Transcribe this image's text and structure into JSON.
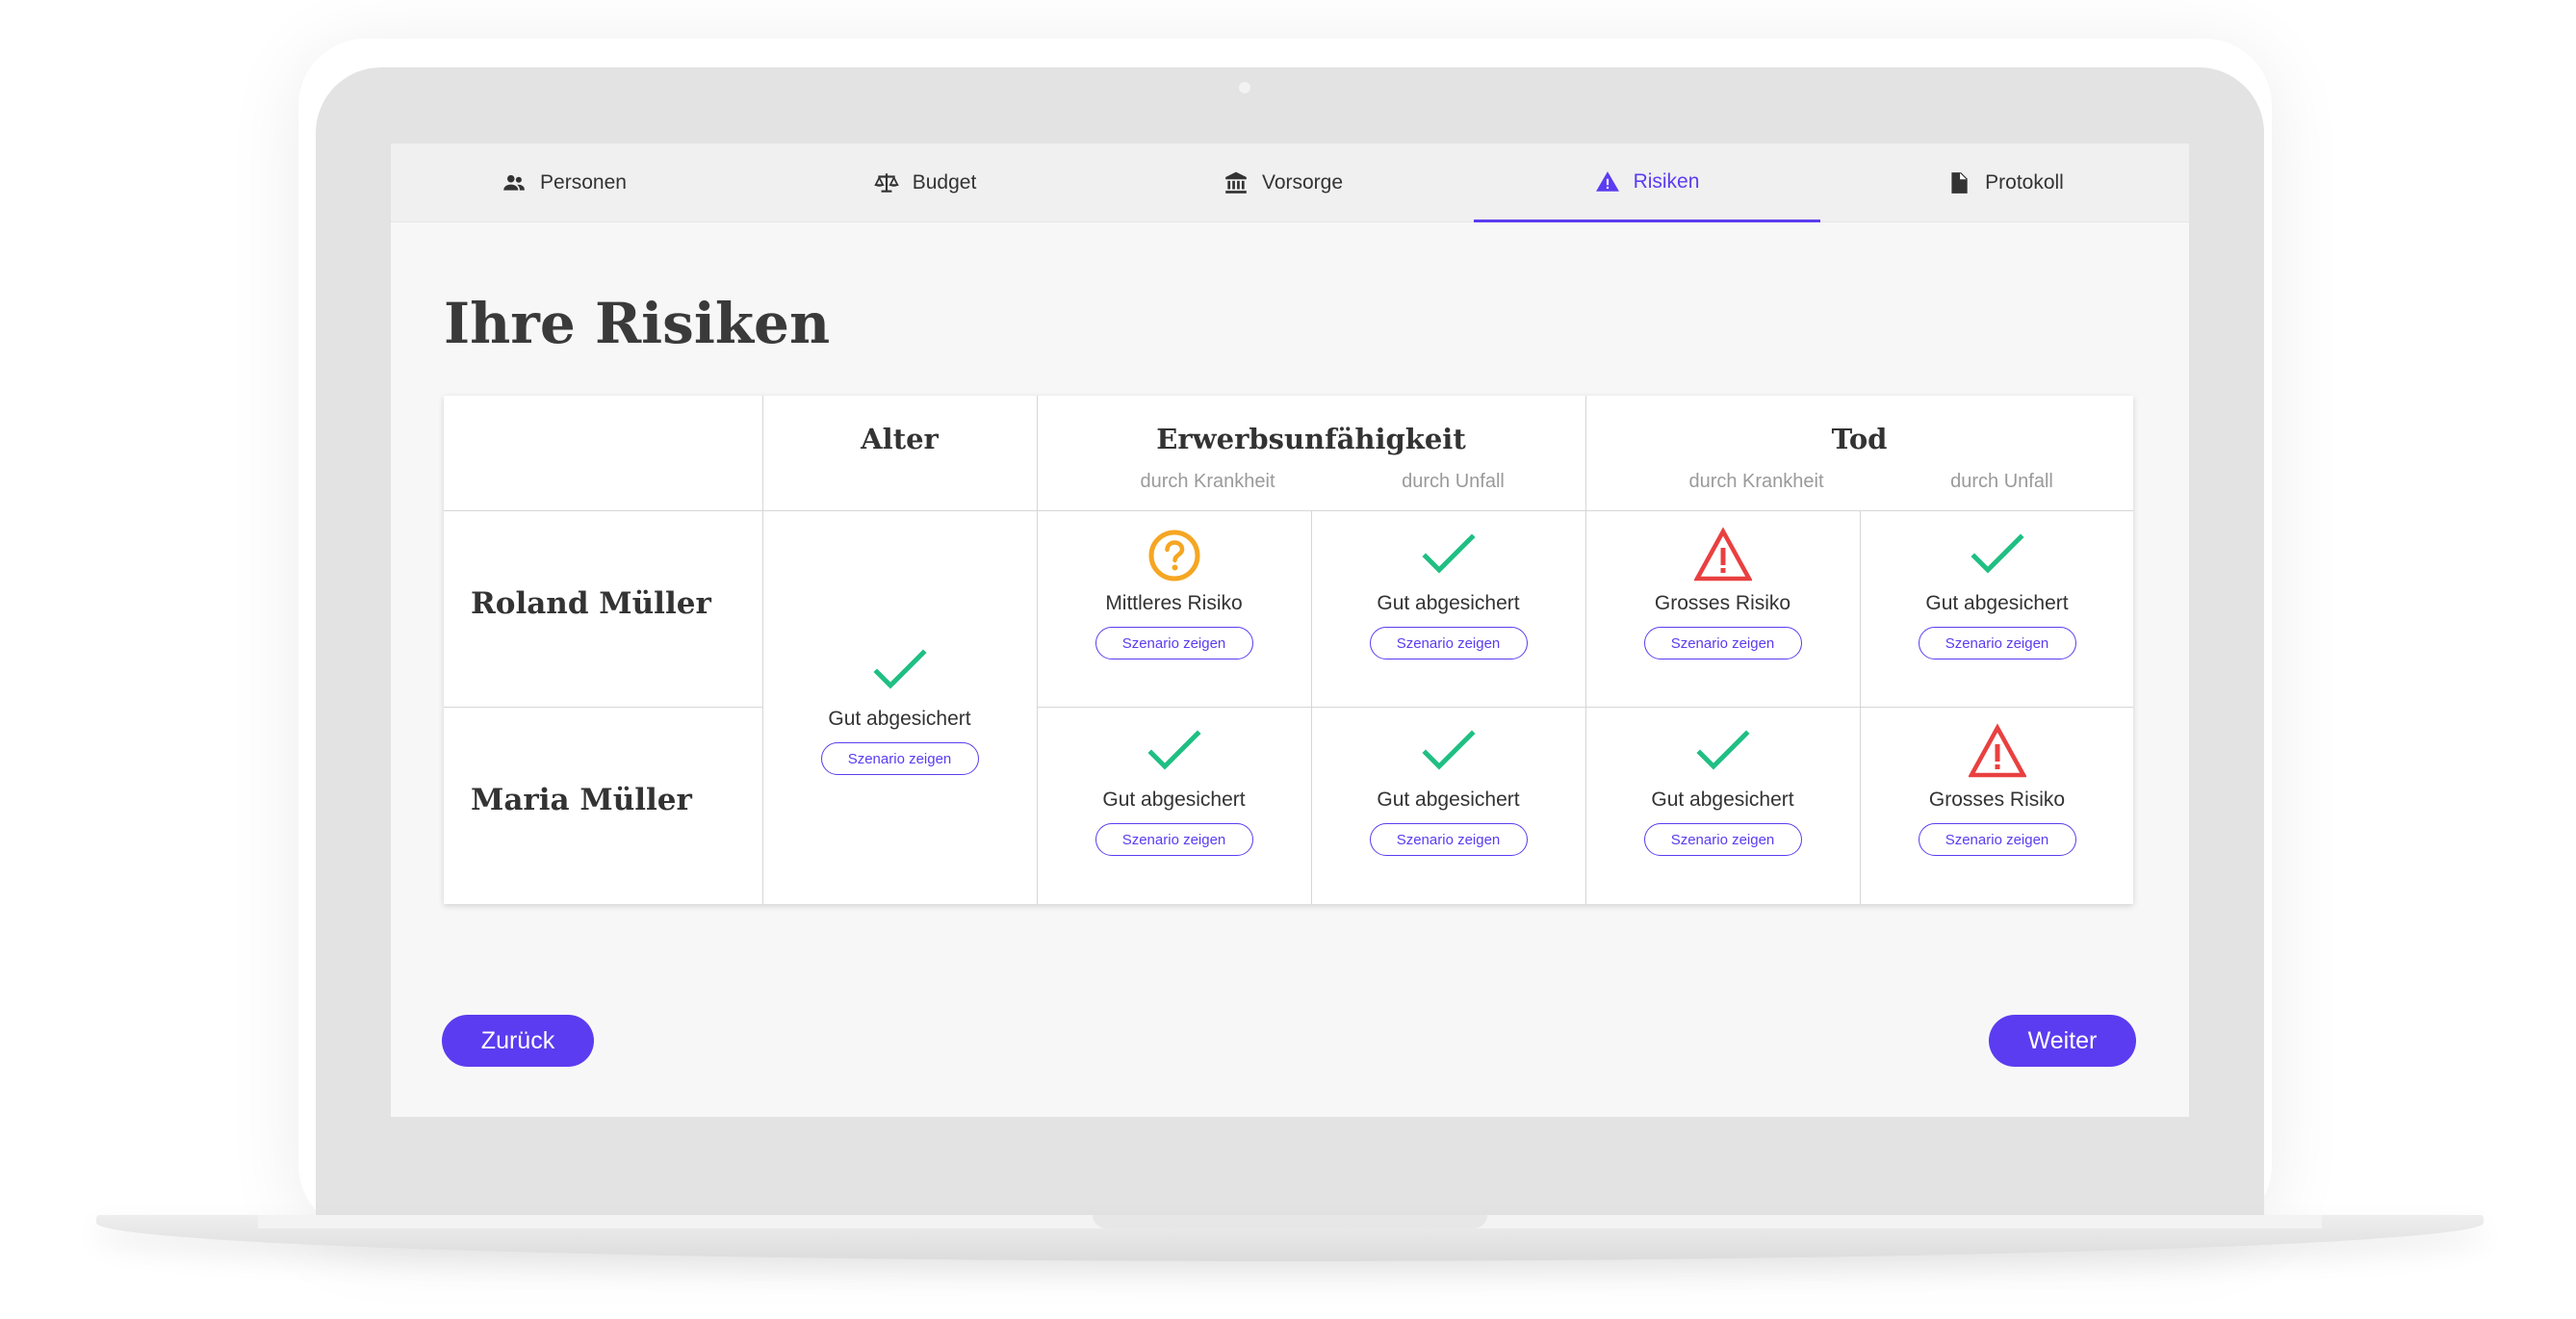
{
  "tabs": [
    {
      "label": "Personen",
      "icon": "people-icon",
      "active": false
    },
    {
      "label": "Budget",
      "icon": "scale-icon",
      "active": false
    },
    {
      "label": "Vorsorge",
      "icon": "bank-icon",
      "active": false
    },
    {
      "label": "Risiken",
      "icon": "warning-icon",
      "active": true
    },
    {
      "label": "Protokoll",
      "icon": "document-icon",
      "active": false
    }
  ],
  "page": {
    "title": "Ihre Risiken"
  },
  "matrix": {
    "columns": {
      "alter": "Alter",
      "erwerb": "Erwerbsunfähigkeit",
      "tod": "Tod",
      "sub_krankheit": "durch Krankheit",
      "sub_unfall": "durch Unfall"
    },
    "rows": [
      {
        "name": "Roland Müller",
        "erwerb_krankheit": {
          "status": "Mittleres Risiko",
          "icon": "question-circle-icon"
        },
        "erwerb_unfall": {
          "status": "Gut abgesichert",
          "icon": "check-icon"
        },
        "tod_krankheit": {
          "status": "Grosses Risiko",
          "icon": "alert-triangle-icon"
        },
        "tod_unfall": {
          "status": "Gut abgesichert",
          "icon": "check-icon"
        }
      },
      {
        "name": "Maria Müller",
        "erwerb_krankheit": {
          "status": "Gut abgesichert",
          "icon": "check-icon"
        },
        "erwerb_unfall": {
          "status": "Gut abgesichert",
          "icon": "check-icon"
        },
        "tod_krankheit": {
          "status": "Gut abgesichert",
          "icon": "check-icon"
        },
        "tod_unfall": {
          "status": "Grosses Risiko",
          "icon": "alert-triangle-icon"
        }
      }
    ],
    "alter_shared": {
      "status": "Gut abgesichert",
      "icon": "check-icon"
    },
    "scenario_label": "Szenario zeigen"
  },
  "buttons": {
    "back": "Zurück",
    "next": "Weiter"
  },
  "colors": {
    "accent": "#5b3cf0",
    "good": "#1fbf83",
    "medium": "#f5a623",
    "high": "#e94040"
  }
}
